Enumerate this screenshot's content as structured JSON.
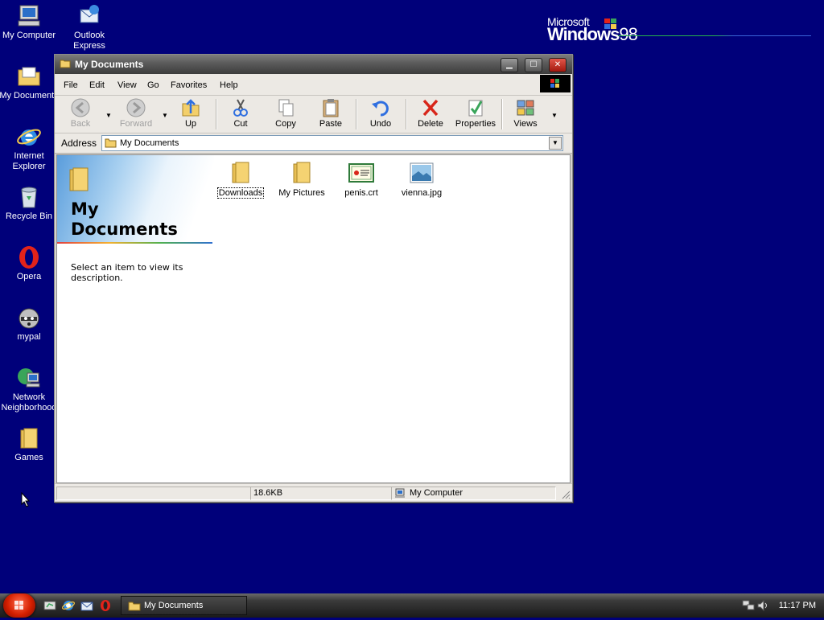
{
  "desktop": {
    "icons": [
      {
        "label": "My Computer"
      },
      {
        "label": "Outlook Express",
        "label1": "Outlook",
        "label2": "Express"
      },
      {
        "label": "My Documents",
        "label1": "My Documents"
      },
      {
        "label1": "Internet",
        "label2": "Explorer"
      },
      {
        "label": "Recycle Bin"
      },
      {
        "label": "Opera"
      },
      {
        "label": "mypal"
      },
      {
        "label1": "Network",
        "label2": "Neighborhood"
      },
      {
        "label": "Games"
      }
    ],
    "brand": {
      "microsoft": "Microsoft",
      "windows": "Windows",
      "version": "98"
    }
  },
  "window": {
    "title": "My Documents",
    "menu": [
      "File",
      "Edit",
      "View",
      "Go",
      "Favorites",
      "Help"
    ],
    "toolbar": {
      "back": "Back",
      "forward": "Forward",
      "up": "Up",
      "cut": "Cut",
      "copy": "Copy",
      "paste": "Paste",
      "undo": "Undo",
      "delete": "Delete",
      "properties": "Properties",
      "views": "Views"
    },
    "address": {
      "label": "Address",
      "value": "My Documents"
    },
    "left_pane": {
      "title_line1": "My",
      "title_line2": "Documents",
      "description": "Select an item to view its description."
    },
    "files": [
      {
        "name": "Downloads",
        "icon": "folder-icon"
      },
      {
        "name": "My Pictures",
        "icon": "folder-icon"
      },
      {
        "name": "penis.crt",
        "icon": "certificate-icon"
      },
      {
        "name": "vienna.jpg",
        "icon": "image-icon"
      }
    ],
    "status": {
      "size": "18.6KB",
      "zone": "My Computer"
    }
  },
  "taskbar": {
    "task": "My Documents",
    "clock": "11:17 PM"
  },
  "colors": {
    "desktop": "#00007a",
    "accent": "#d41f00"
  }
}
